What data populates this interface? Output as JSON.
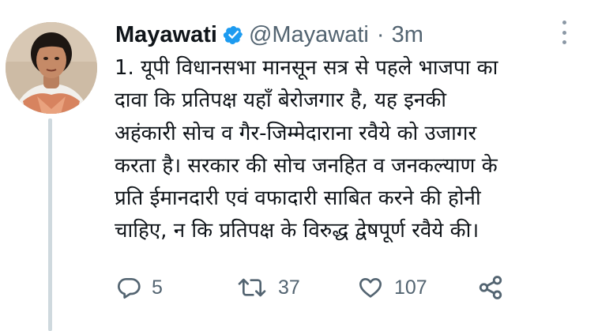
{
  "tweet": {
    "author": {
      "name": "Mayawati",
      "handle": "@Mayawati",
      "verified": true,
      "separator": "·",
      "time": "3m"
    },
    "text_lines": [
      "1. यूपी विधानसभा मानसून सत्र से पहले भाजपा का",
      "दावा कि प्रतिपक्ष यहाँ बेरोजगार है, यह इनकी",
      "अहंकारी सोच व गैर-जिम्मेदाराना रवैये को उजागर",
      "करता है। सरकार की सोच जनहित व जनकल्याण के",
      "प्रति ईमानदारी एवं वफादारी साबित करने की होनी",
      "चाहिए, न कि प्रतिपक्ष के विरुद्ध द्वेषपूर्ण रवैये की।"
    ],
    "actions": {
      "replies": "5",
      "retweets": "37",
      "likes": "107"
    }
  },
  "colors": {
    "text": "#0f1419",
    "secondary": "#536471",
    "verified_blue": "#1d9bf0",
    "thread_line": "#cfd9de"
  },
  "icons": [
    "verified-badge-icon",
    "more-options-icon",
    "reply-icon",
    "retweet-icon",
    "like-icon",
    "share-icon"
  ]
}
